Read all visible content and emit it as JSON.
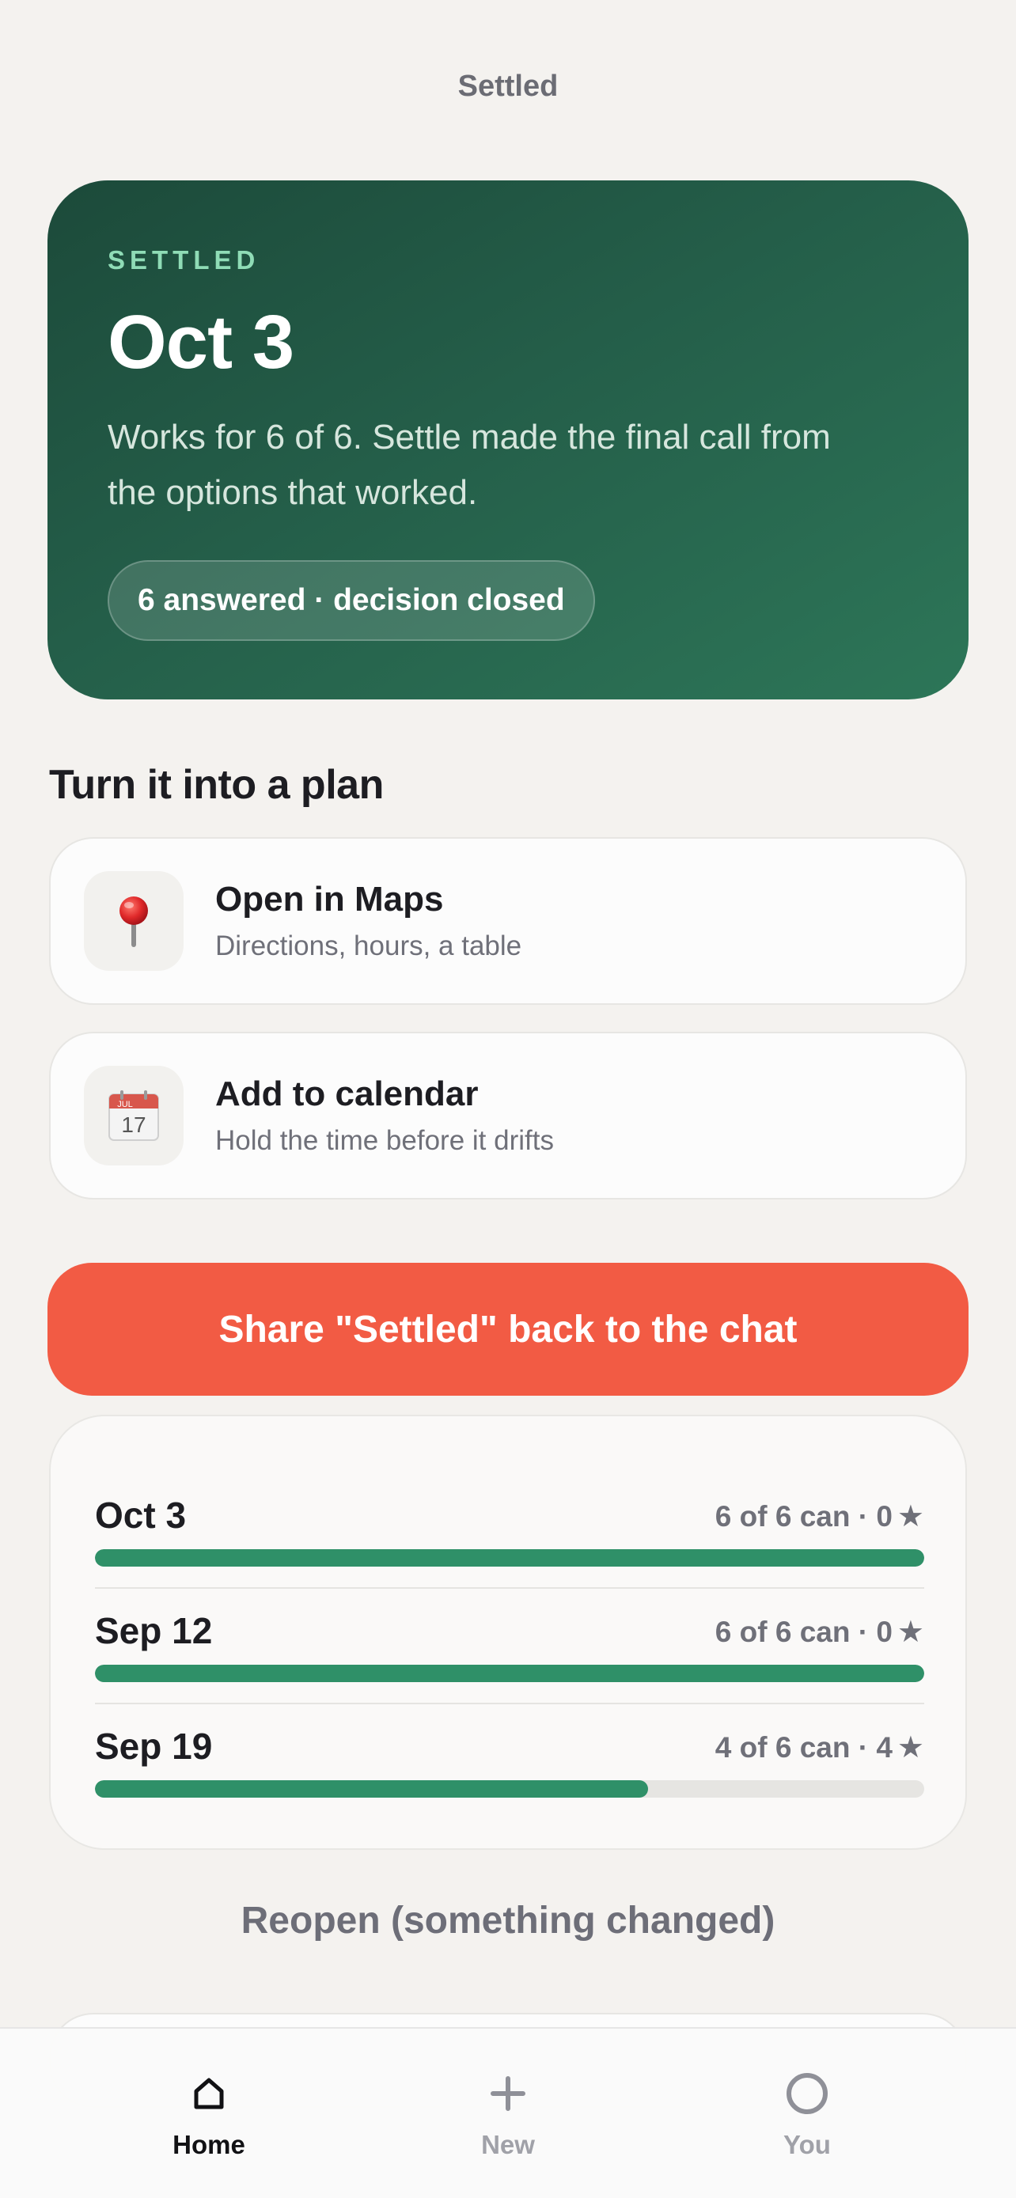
{
  "header": {
    "title": "Settled"
  },
  "hero": {
    "eyebrow": "SETTLED",
    "date": "Oct 3",
    "description": "Works for 6 of 6. Settle made the final call from the options that worked.",
    "pill": "6 answered · decision closed"
  },
  "plan": {
    "title": "Turn it into a plan",
    "actions": [
      {
        "icon": "map-pin-icon",
        "title": "Open in Maps",
        "subtitle": "Directions, hours, a table"
      },
      {
        "icon": "calendar-icon",
        "title": "Add to calendar",
        "subtitle": "Hold the time before it drifts",
        "icon_month": "JUL",
        "icon_day": "17"
      }
    ]
  },
  "share": {
    "label": "Share \"Settled\" back to the chat"
  },
  "results": [
    {
      "date": "Oct 3",
      "meta": "6 of 6 can · 0",
      "fraction": 1.0
    },
    {
      "date": "Sep 12",
      "meta": "6 of 6 can · 0",
      "fraction": 1.0
    },
    {
      "date": "Sep 19",
      "meta": "4 of 6 can · 4",
      "fraction": 0.6667
    }
  ],
  "reopen": {
    "label": "Reopen (something changed)"
  },
  "tabbar": {
    "tabs": [
      {
        "label": "Home",
        "icon": "home-icon",
        "active": true
      },
      {
        "label": "New",
        "icon": "plus-icon",
        "active": false
      },
      {
        "label": "You",
        "icon": "profile-icon",
        "active": false
      }
    ]
  },
  "colors": {
    "accent": "#f25b44",
    "hero_green": "#245e49",
    "bar_green": "#2f9068",
    "background": "#f4f2ef"
  }
}
